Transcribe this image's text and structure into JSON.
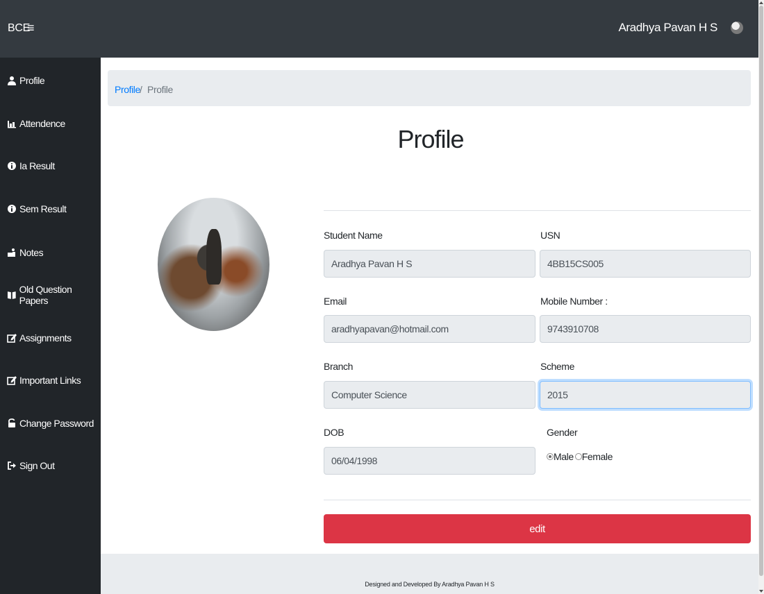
{
  "topbar": {
    "brand": "BCE",
    "menu_icon": "≡",
    "username": "Aradhya Pavan H S"
  },
  "sidebar": {
    "items": [
      {
        "label": "Profile",
        "icon": "user-icon"
      },
      {
        "label": "Attendence",
        "icon": "chart-icon"
      },
      {
        "label": "Ia Result",
        "icon": "info-icon"
      },
      {
        "label": "Sem Result",
        "icon": "info-icon"
      },
      {
        "label": "Notes",
        "icon": "reader-icon"
      },
      {
        "label": "Old Question Papers",
        "icon": "book-icon"
      },
      {
        "label": "Assignments",
        "icon": "edit-icon"
      },
      {
        "label": "Important Links",
        "icon": "edit-icon"
      },
      {
        "label": "Change Password",
        "icon": "lock-icon"
      },
      {
        "label": "Sign Out",
        "icon": "signout-icon"
      }
    ]
  },
  "breadcrumb": {
    "link": "Profile",
    "separator": "/",
    "current": "Profile"
  },
  "page_title": "Profile",
  "form": {
    "student_name": {
      "label": "Student Name",
      "value": "Aradhya Pavan H S"
    },
    "usn": {
      "label": "USN",
      "value": "4BB15CS005"
    },
    "email": {
      "label": "Email",
      "value": "aradhyapavan@hotmail.com"
    },
    "mobile": {
      "label": "Mobile Number :",
      "value": "9743910708"
    },
    "branch": {
      "label": "Branch",
      "value": "Computer Science"
    },
    "scheme": {
      "label": "Scheme",
      "value": "2015"
    },
    "dob": {
      "label": "DOB",
      "value": "06/04/1998"
    },
    "gender": {
      "label": "Gender",
      "male": "Male",
      "female": "Female",
      "selected": "Male"
    }
  },
  "edit_button": "edit",
  "footer": "Designed and Developed By Aradhya Pavan H S",
  "colors": {
    "topbar": "#343a40",
    "sidebar": "#212529",
    "link": "#007bff",
    "danger": "#dc3545",
    "light": "#e9ecef"
  }
}
